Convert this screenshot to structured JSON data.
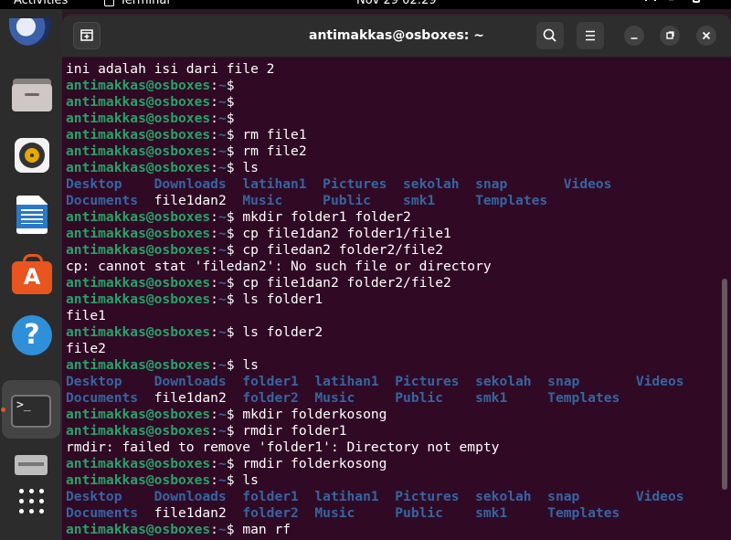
{
  "topbar": {
    "activities": "Activities",
    "app_name": "Terminal",
    "clock": "Nov 29  02:29",
    "icons": [
      "network-icon",
      "volume-icon",
      "power-icon"
    ]
  },
  "dock": {
    "items": [
      {
        "name": "thunderbird-icon",
        "label": "Thunderbird Mail"
      },
      {
        "name": "files-icon",
        "label": "Files"
      },
      {
        "name": "rhythmbox-icon",
        "label": "Rhythmbox"
      },
      {
        "name": "libreoffice-writer-icon",
        "label": "LibreOffice Writer"
      },
      {
        "name": "ubuntu-software-icon",
        "label": "Ubuntu Software"
      },
      {
        "name": "help-icon",
        "label": "Help",
        "glyph": "?"
      },
      {
        "name": "terminal-icon",
        "label": "Terminal",
        "glyph": ">_",
        "running": true
      },
      {
        "name": "removable-drive-icon",
        "label": "Removable Drive"
      },
      {
        "name": "show-applications-icon",
        "label": "Show Applications"
      }
    ],
    "accent": "#e95420"
  },
  "window": {
    "title": "antimakkas@osboxes: ~",
    "buttons": [
      "new-tab",
      "search",
      "menu",
      "minimize",
      "maximize",
      "close"
    ]
  },
  "colors": {
    "background": "#300a24",
    "prompt_user": "#26a269",
    "prompt_path": "#3465a4",
    "directory": "#3465a4",
    "text": "#ffffff"
  },
  "terminal": {
    "lines": [
      {
        "segments": [
          {
            "t": "ini adalah isi dari file 2",
            "c": "text"
          }
        ]
      },
      {
        "segments": [
          {
            "t": "antimakkas@osboxes",
            "c": "user"
          },
          {
            "t": ":",
            "c": "text"
          },
          {
            "t": "~",
            "c": "path"
          },
          {
            "t": "$",
            "c": "text"
          }
        ]
      },
      {
        "segments": [
          {
            "t": "antimakkas@osboxes",
            "c": "user"
          },
          {
            "t": ":",
            "c": "text"
          },
          {
            "t": "~",
            "c": "path"
          },
          {
            "t": "$",
            "c": "text"
          }
        ]
      },
      {
        "segments": [
          {
            "t": "antimakkas@osboxes",
            "c": "user"
          },
          {
            "t": ":",
            "c": "text"
          },
          {
            "t": "~",
            "c": "path"
          },
          {
            "t": "$",
            "c": "text"
          }
        ]
      },
      {
        "segments": [
          {
            "t": "antimakkas@osboxes",
            "c": "user"
          },
          {
            "t": ":",
            "c": "text"
          },
          {
            "t": "~",
            "c": "path"
          },
          {
            "t": "$ rm file1",
            "c": "text"
          }
        ]
      },
      {
        "segments": [
          {
            "t": "antimakkas@osboxes",
            "c": "user"
          },
          {
            "t": ":",
            "c": "text"
          },
          {
            "t": "~",
            "c": "path"
          },
          {
            "t": "$ rm file2",
            "c": "text"
          }
        ]
      },
      {
        "segments": [
          {
            "t": "antimakkas@osboxes",
            "c": "user"
          },
          {
            "t": ":",
            "c": "text"
          },
          {
            "t": "~",
            "c": "path"
          },
          {
            "t": "$ ls",
            "c": "text"
          }
        ]
      },
      {
        "segments": [
          {
            "t": "Desktop    Downloads  latihan1  Pictures  sekolah  snap       Videos",
            "c": "dir"
          }
        ]
      },
      {
        "segments": [
          {
            "t": "Documents  ",
            "c": "dir"
          },
          {
            "t": "file1dan2  ",
            "c": "text"
          },
          {
            "t": "Music     Public    smk1     Templates",
            "c": "dir"
          }
        ]
      },
      {
        "segments": [
          {
            "t": "antimakkas@osboxes",
            "c": "user"
          },
          {
            "t": ":",
            "c": "text"
          },
          {
            "t": "~",
            "c": "path"
          },
          {
            "t": "$ mkdir folder1 folder2",
            "c": "text"
          }
        ]
      },
      {
        "segments": [
          {
            "t": "antimakkas@osboxes",
            "c": "user"
          },
          {
            "t": ":",
            "c": "text"
          },
          {
            "t": "~",
            "c": "path"
          },
          {
            "t": "$ cp file1dan2 folder1/file1",
            "c": "text"
          }
        ]
      },
      {
        "segments": [
          {
            "t": "antimakkas@osboxes",
            "c": "user"
          },
          {
            "t": ":",
            "c": "text"
          },
          {
            "t": "~",
            "c": "path"
          },
          {
            "t": "$ cp filedan2 folder2/file2",
            "c": "text"
          }
        ]
      },
      {
        "segments": [
          {
            "t": "cp: cannot stat 'filedan2': No such file or directory",
            "c": "text"
          }
        ]
      },
      {
        "segments": [
          {
            "t": "antimakkas@osboxes",
            "c": "user"
          },
          {
            "t": ":",
            "c": "text"
          },
          {
            "t": "~",
            "c": "path"
          },
          {
            "t": "$ cp file1dan2 folder2/file2",
            "c": "text"
          }
        ]
      },
      {
        "segments": [
          {
            "t": "antimakkas@osboxes",
            "c": "user"
          },
          {
            "t": ":",
            "c": "text"
          },
          {
            "t": "~",
            "c": "path"
          },
          {
            "t": "$ ls folder1",
            "c": "text"
          }
        ]
      },
      {
        "segments": [
          {
            "t": "file1",
            "c": "text"
          }
        ]
      },
      {
        "segments": [
          {
            "t": "antimakkas@osboxes",
            "c": "user"
          },
          {
            "t": ":",
            "c": "text"
          },
          {
            "t": "~",
            "c": "path"
          },
          {
            "t": "$ ls folder2",
            "c": "text"
          }
        ]
      },
      {
        "segments": [
          {
            "t": "file2",
            "c": "text"
          }
        ]
      },
      {
        "segments": [
          {
            "t": "antimakkas@osboxes",
            "c": "user"
          },
          {
            "t": ":",
            "c": "text"
          },
          {
            "t": "~",
            "c": "path"
          },
          {
            "t": "$ ls",
            "c": "text"
          }
        ]
      },
      {
        "segments": [
          {
            "t": "Desktop    Downloads  folder1  latihan1  Pictures  sekolah  snap       Videos",
            "c": "dir"
          }
        ]
      },
      {
        "segments": [
          {
            "t": "Documents  ",
            "c": "dir"
          },
          {
            "t": "file1dan2  ",
            "c": "text"
          },
          {
            "t": "folder2  Music     Public    smk1     Templates",
            "c": "dir"
          }
        ]
      },
      {
        "segments": [
          {
            "t": "antimakkas@osboxes",
            "c": "user"
          },
          {
            "t": ":",
            "c": "text"
          },
          {
            "t": "~",
            "c": "path"
          },
          {
            "t": "$ mkdir folderkosong",
            "c": "text"
          }
        ]
      },
      {
        "segments": [
          {
            "t": "antimakkas@osboxes",
            "c": "user"
          },
          {
            "t": ":",
            "c": "text"
          },
          {
            "t": "~",
            "c": "path"
          },
          {
            "t": "$ rmdir folder1",
            "c": "text"
          }
        ]
      },
      {
        "segments": [
          {
            "t": "rmdir: failed to remove 'folder1': Directory not empty",
            "c": "text"
          }
        ]
      },
      {
        "segments": [
          {
            "t": "antimakkas@osboxes",
            "c": "user"
          },
          {
            "t": ":",
            "c": "text"
          },
          {
            "t": "~",
            "c": "path"
          },
          {
            "t": "$ rmdir folderkosong",
            "c": "text"
          }
        ]
      },
      {
        "segments": [
          {
            "t": "antimakkas@osboxes",
            "c": "user"
          },
          {
            "t": ":",
            "c": "text"
          },
          {
            "t": "~",
            "c": "path"
          },
          {
            "t": "$ ls",
            "c": "text"
          }
        ]
      },
      {
        "segments": [
          {
            "t": "Desktop    Downloads  folder1  latihan1  Pictures  sekolah  snap       Videos",
            "c": "dir"
          }
        ]
      },
      {
        "segments": [
          {
            "t": "Documents  ",
            "c": "dir"
          },
          {
            "t": "file1dan2  ",
            "c": "text"
          },
          {
            "t": "folder2  Music     Public    smk1     Templates",
            "c": "dir"
          }
        ]
      },
      {
        "segments": [
          {
            "t": "antimakkas@osboxes",
            "c": "user"
          },
          {
            "t": ":",
            "c": "text"
          },
          {
            "t": "~",
            "c": "path"
          },
          {
            "t": "$ man rf",
            "c": "text"
          }
        ]
      }
    ]
  }
}
